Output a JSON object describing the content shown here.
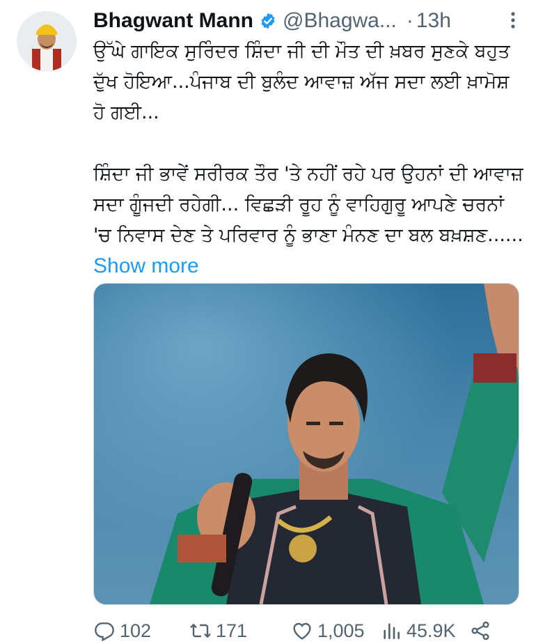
{
  "tweet": {
    "author_name": "Bhagwant Mann",
    "handle": "@Bhagwa...",
    "separator": "·",
    "time": "13h",
    "paragraph1": "ਉੱਘੇ ਗਾਇਕ ਸੁਰਿੰਦਰ ਸ਼ਿੰਦਾ ਜੀ ਦੀ ਮੌਤ ਦੀ ਖ਼ਬਰ ਸੁਣਕੇ ਬਹੁਤ ਦੁੱਖ ਹੋਇਆ...ਪੰਜਾਬ ਦੀ ਬੁਲੰਦ ਆਵਾਜ਼ ਅੱਜ ਸਦਾ ਲਈ ਖ਼ਾਮੋਸ਼ ਹੋ ਗਈ...",
    "paragraph2": "ਸ਼ਿੰਦਾ ਜੀ ਭਾਵੇਂ ਸਰੀਰਕ ਤੌਰ 'ਤੇ ਨਹੀਂ ਰਹੇ ਪਰ ਉਹਨਾਂ ਦੀ ਆਵਾਜ਼ ਸਦਾ ਗੂੰਜਦੀ ਰਹੇਗੀ... ਵਿਛੜੀ ਰੂਹ ਨੂੰ ਵਾਹਿਗੁਰੂ ਆਪਣੇ ਚਰਨਾਂ 'ਚ ਨਿਵਾਸ ਦੇਣ ਤੇ ਪਰਿਵਾਰ ਨੂੰ ਭਾਣਾ ਮੰਨਣ ਦਾ ਬਲ ਬਖ਼ਸ਼ਣ......",
    "show_more": "Show more"
  },
  "icons": {
    "avatar": "avatar-photo",
    "verified": "verified-badge-icon",
    "more": "more-vertical-icon",
    "reply": "reply-icon",
    "retweet": "retweet-icon",
    "like": "heart-icon",
    "views": "views-icon",
    "share": "share-icon"
  },
  "actions": {
    "replies": "102",
    "retweets": "171",
    "likes": "1,005",
    "views": "45.9K"
  },
  "colors": {
    "text": "#0f1419",
    "secondary": "#536471",
    "accent": "#1d9bf0",
    "verified": "#1d9bf0"
  }
}
